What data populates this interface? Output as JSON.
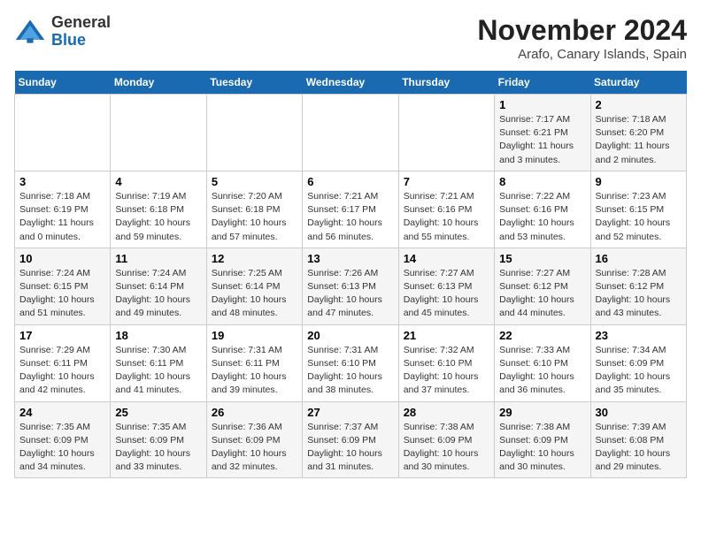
{
  "header": {
    "logo_general": "General",
    "logo_blue": "Blue",
    "month_title": "November 2024",
    "location": "Arafo, Canary Islands, Spain"
  },
  "calendar": {
    "days_of_week": [
      "Sunday",
      "Monday",
      "Tuesday",
      "Wednesday",
      "Thursday",
      "Friday",
      "Saturday"
    ],
    "weeks": [
      [
        {
          "day": "",
          "info": ""
        },
        {
          "day": "",
          "info": ""
        },
        {
          "day": "",
          "info": ""
        },
        {
          "day": "",
          "info": ""
        },
        {
          "day": "",
          "info": ""
        },
        {
          "day": "1",
          "info": "Sunrise: 7:17 AM\nSunset: 6:21 PM\nDaylight: 11 hours and 3 minutes."
        },
        {
          "day": "2",
          "info": "Sunrise: 7:18 AM\nSunset: 6:20 PM\nDaylight: 11 hours and 2 minutes."
        }
      ],
      [
        {
          "day": "3",
          "info": "Sunrise: 7:18 AM\nSunset: 6:19 PM\nDaylight: 11 hours and 0 minutes."
        },
        {
          "day": "4",
          "info": "Sunrise: 7:19 AM\nSunset: 6:18 PM\nDaylight: 10 hours and 59 minutes."
        },
        {
          "day": "5",
          "info": "Sunrise: 7:20 AM\nSunset: 6:18 PM\nDaylight: 10 hours and 57 minutes."
        },
        {
          "day": "6",
          "info": "Sunrise: 7:21 AM\nSunset: 6:17 PM\nDaylight: 10 hours and 56 minutes."
        },
        {
          "day": "7",
          "info": "Sunrise: 7:21 AM\nSunset: 6:16 PM\nDaylight: 10 hours and 55 minutes."
        },
        {
          "day": "8",
          "info": "Sunrise: 7:22 AM\nSunset: 6:16 PM\nDaylight: 10 hours and 53 minutes."
        },
        {
          "day": "9",
          "info": "Sunrise: 7:23 AM\nSunset: 6:15 PM\nDaylight: 10 hours and 52 minutes."
        }
      ],
      [
        {
          "day": "10",
          "info": "Sunrise: 7:24 AM\nSunset: 6:15 PM\nDaylight: 10 hours and 51 minutes."
        },
        {
          "day": "11",
          "info": "Sunrise: 7:24 AM\nSunset: 6:14 PM\nDaylight: 10 hours and 49 minutes."
        },
        {
          "day": "12",
          "info": "Sunrise: 7:25 AM\nSunset: 6:14 PM\nDaylight: 10 hours and 48 minutes."
        },
        {
          "day": "13",
          "info": "Sunrise: 7:26 AM\nSunset: 6:13 PM\nDaylight: 10 hours and 47 minutes."
        },
        {
          "day": "14",
          "info": "Sunrise: 7:27 AM\nSunset: 6:13 PM\nDaylight: 10 hours and 45 minutes."
        },
        {
          "day": "15",
          "info": "Sunrise: 7:27 AM\nSunset: 6:12 PM\nDaylight: 10 hours and 44 minutes."
        },
        {
          "day": "16",
          "info": "Sunrise: 7:28 AM\nSunset: 6:12 PM\nDaylight: 10 hours and 43 minutes."
        }
      ],
      [
        {
          "day": "17",
          "info": "Sunrise: 7:29 AM\nSunset: 6:11 PM\nDaylight: 10 hours and 42 minutes."
        },
        {
          "day": "18",
          "info": "Sunrise: 7:30 AM\nSunset: 6:11 PM\nDaylight: 10 hours and 41 minutes."
        },
        {
          "day": "19",
          "info": "Sunrise: 7:31 AM\nSunset: 6:11 PM\nDaylight: 10 hours and 39 minutes."
        },
        {
          "day": "20",
          "info": "Sunrise: 7:31 AM\nSunset: 6:10 PM\nDaylight: 10 hours and 38 minutes."
        },
        {
          "day": "21",
          "info": "Sunrise: 7:32 AM\nSunset: 6:10 PM\nDaylight: 10 hours and 37 minutes."
        },
        {
          "day": "22",
          "info": "Sunrise: 7:33 AM\nSunset: 6:10 PM\nDaylight: 10 hours and 36 minutes."
        },
        {
          "day": "23",
          "info": "Sunrise: 7:34 AM\nSunset: 6:09 PM\nDaylight: 10 hours and 35 minutes."
        }
      ],
      [
        {
          "day": "24",
          "info": "Sunrise: 7:35 AM\nSunset: 6:09 PM\nDaylight: 10 hours and 34 minutes."
        },
        {
          "day": "25",
          "info": "Sunrise: 7:35 AM\nSunset: 6:09 PM\nDaylight: 10 hours and 33 minutes."
        },
        {
          "day": "26",
          "info": "Sunrise: 7:36 AM\nSunset: 6:09 PM\nDaylight: 10 hours and 32 minutes."
        },
        {
          "day": "27",
          "info": "Sunrise: 7:37 AM\nSunset: 6:09 PM\nDaylight: 10 hours and 31 minutes."
        },
        {
          "day": "28",
          "info": "Sunrise: 7:38 AM\nSunset: 6:09 PM\nDaylight: 10 hours and 30 minutes."
        },
        {
          "day": "29",
          "info": "Sunrise: 7:38 AM\nSunset: 6:09 PM\nDaylight: 10 hours and 30 minutes."
        },
        {
          "day": "30",
          "info": "Sunrise: 7:39 AM\nSunset: 6:08 PM\nDaylight: 10 hours and 29 minutes."
        }
      ]
    ]
  }
}
